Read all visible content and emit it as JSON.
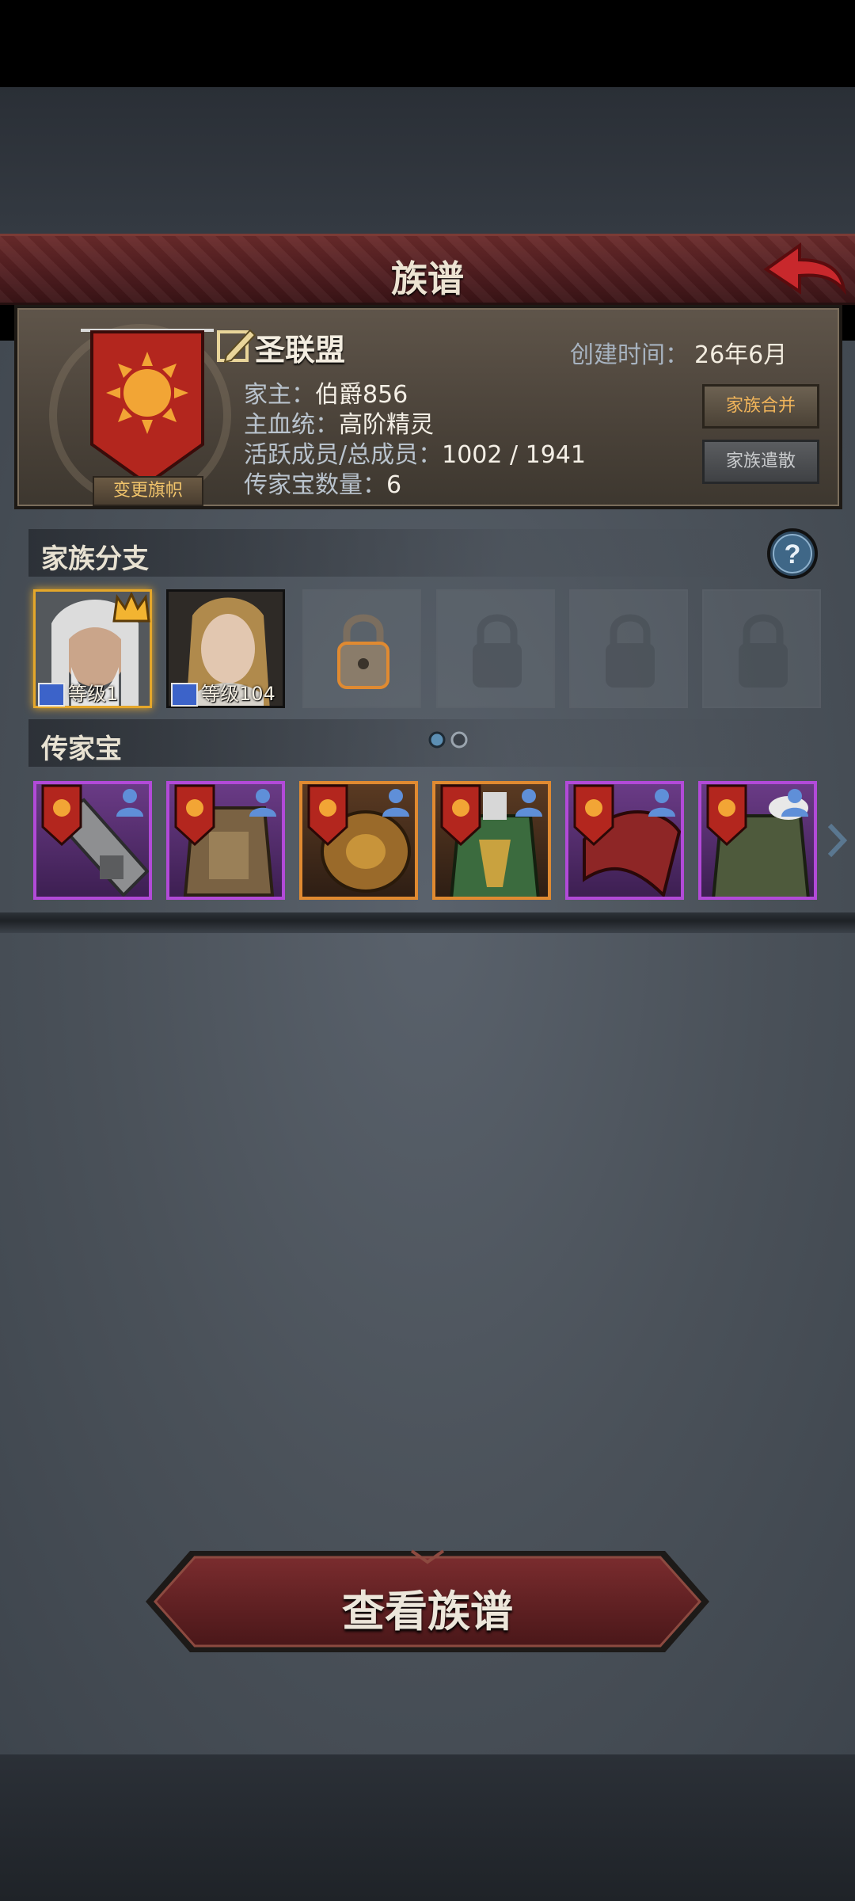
{
  "title": "族谱",
  "family": {
    "name": "圣联盟",
    "created_label": "创建时间：",
    "created_value": "26年6月",
    "leader_label": "家主：",
    "leader_value": "伯爵856",
    "bloodline_label": "主血统：",
    "bloodline_value": "高阶精灵",
    "members_label": "活跃成员/总成员：",
    "members_value": "1002 / 1941",
    "heirloom_count_label": "传家宝数量：",
    "heirloom_count_value": "6",
    "change_banner_label": "变更旗帜",
    "merge_label": "家族合并",
    "dissolve_label": "家族遣散"
  },
  "branches": {
    "header": "家族分支",
    "members": [
      {
        "level_label": "等级1",
        "portrait": "elder-portrait",
        "leader": true
      },
      {
        "level_label": "等级104",
        "portrait": "elf-portrait",
        "leader": false
      }
    ],
    "locked_slots": 4
  },
  "heirlooms": {
    "header": "传家宝",
    "items": [
      {
        "name": "greatsword-icon",
        "rarity": "purple"
      },
      {
        "name": "bronze-armor-icon",
        "rarity": "purple"
      },
      {
        "name": "golden-mask-icon",
        "rarity": "orange"
      },
      {
        "name": "green-armor-icon",
        "rarity": "orange"
      },
      {
        "name": "red-cloak-icon",
        "rarity": "purple"
      },
      {
        "name": "fur-coat-icon",
        "rarity": "purple"
      }
    ]
  },
  "view_button_label": "查看族谱",
  "colors": {
    "accent_red": "#5a1f22",
    "gold": "#e5a72a",
    "purple_rarity": "#b24ad8",
    "orange_rarity": "#e08a31"
  }
}
